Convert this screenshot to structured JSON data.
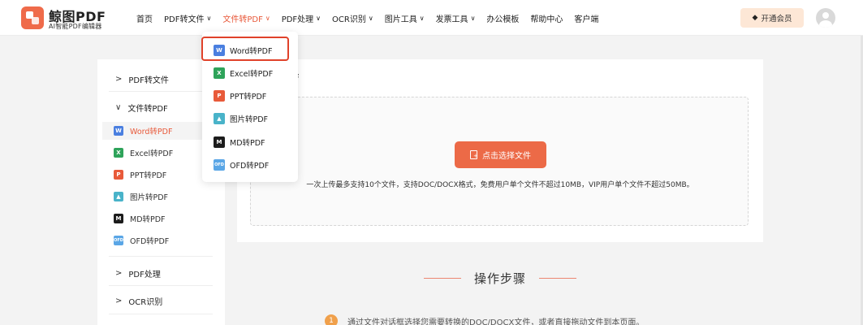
{
  "brand": {
    "name": "鲸图PDF",
    "tagline": "AI智能PDF编辑器"
  },
  "nav": [
    {
      "label": "首页",
      "has_menu": false
    },
    {
      "label": "PDF转文件",
      "has_menu": true
    },
    {
      "label": "文件转PDF",
      "has_menu": true,
      "active": true
    },
    {
      "label": "PDF处理",
      "has_menu": true
    },
    {
      "label": "OCR识别",
      "has_menu": true
    },
    {
      "label": "图片工具",
      "has_menu": true
    },
    {
      "label": "发票工具",
      "has_menu": true
    },
    {
      "label": "办公模板",
      "has_menu": false
    },
    {
      "label": "帮助中心",
      "has_menu": false
    },
    {
      "label": "客户端",
      "has_menu": false
    }
  ],
  "header": {
    "vip_label": "开通会员"
  },
  "dropdown": {
    "items": [
      {
        "label": "Word转PDF",
        "icon": "word-icon",
        "glyph": "W",
        "highlighted": true
      },
      {
        "label": "Excel转PDF",
        "icon": "excel-icon",
        "glyph": "X"
      },
      {
        "label": "PPT转PDF",
        "icon": "ppt-icon",
        "glyph": "P"
      },
      {
        "label": "图片转PDF",
        "icon": "image-icon",
        "glyph": "▲"
      },
      {
        "label": "MD转PDF",
        "icon": "md-icon",
        "glyph": "M"
      },
      {
        "label": "OFD转PDF",
        "icon": "ofd-icon",
        "glyph": "OFD"
      }
    ]
  },
  "sidebar": {
    "groups": [
      {
        "label": "PDF转文件",
        "caret": ">",
        "expanded": false
      },
      {
        "label": "文件转PDF",
        "caret": "∨",
        "expanded": true
      },
      {
        "label": "PDF处理",
        "caret": ">",
        "expanded": false
      },
      {
        "label": "OCR识别",
        "caret": ">",
        "expanded": false
      }
    ],
    "items": [
      {
        "label": "Word转PDF",
        "icon": "word-icon",
        "glyph": "W",
        "active": true
      },
      {
        "label": "Excel转PDF",
        "icon": "excel-icon",
        "glyph": "X"
      },
      {
        "label": "PPT转PDF",
        "icon": "ppt-icon",
        "glyph": "P"
      },
      {
        "label": "图片转PDF",
        "icon": "image-icon",
        "glyph": "▲"
      },
      {
        "label": "MD转PDF",
        "icon": "md-icon",
        "glyph": "M"
      },
      {
        "label": "OFD转PDF",
        "icon": "ofd-icon",
        "glyph": "OFD"
      }
    ]
  },
  "main": {
    "title_visible": "DF",
    "upload_label": "点击选择文件",
    "upload_hint": "一次上传最多支持10个文件，支持DOC/DOCX格式，免费用户单个文件不超过10MB，VIP用户单个文件不超过50MB。"
  },
  "steps": {
    "title": "操作步骤",
    "items": [
      {
        "number": "1",
        "text": "通过文件对话框选择您需要转换的DOC/DOCX文件，或者直接拖动文件到本页面。"
      }
    ]
  },
  "colors": {
    "accent": "#e8593a",
    "button": "#ec6a47",
    "vip_bg": "#fde7d6",
    "highlight_border": "#e0422a"
  }
}
